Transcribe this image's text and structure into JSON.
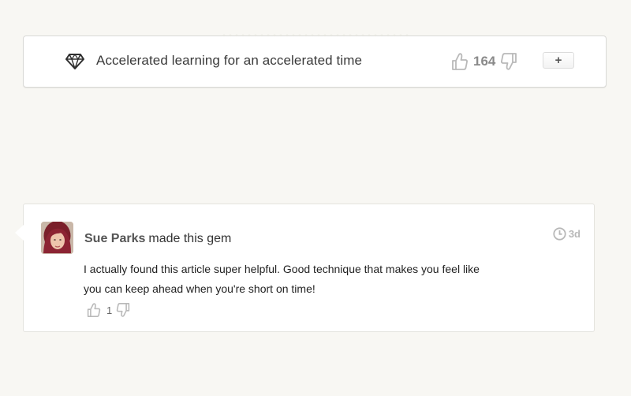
{
  "gem": {
    "title": "Accelerated learning for an accelerated time",
    "vote_count": "164",
    "add_label": "+",
    "icon": "gem-icon"
  },
  "comment": {
    "author": "Sue Parks",
    "action_text": "made this gem",
    "time_ago": "3d",
    "body_line1": "I actually found this article super helpful. Good technique that makes you feel like",
    "body_line2": "you can keep ahead when you're short on time!",
    "vote_count": "1"
  },
  "colors": {
    "background": "#f8f7f3",
    "card": "#ffffff",
    "muted_icon": "#b9b9b9",
    "vote_count": "#8a8a8a"
  }
}
